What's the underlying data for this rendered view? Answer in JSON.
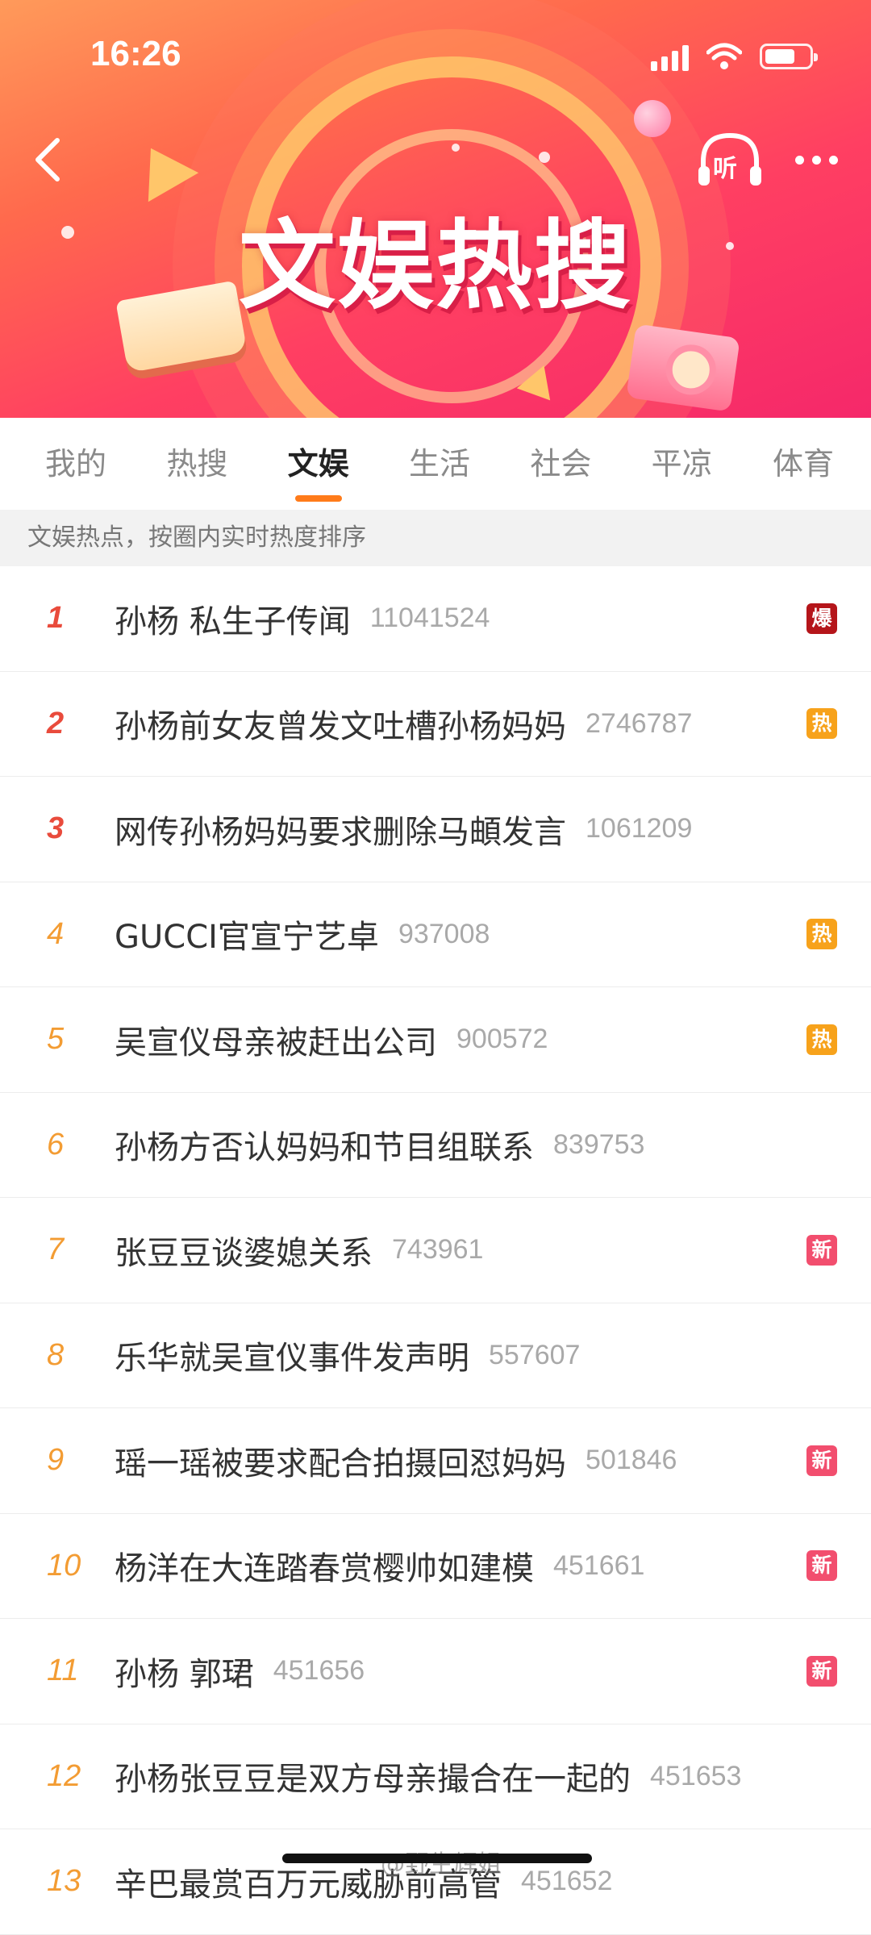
{
  "status_bar": {
    "time": "16:26"
  },
  "header": {
    "banner_title": "文娱热搜",
    "listen_label": "听"
  },
  "tabs": [
    {
      "label": "我的",
      "active": false
    },
    {
      "label": "热搜",
      "active": false
    },
    {
      "label": "文娱",
      "active": true
    },
    {
      "label": "生活",
      "active": false
    },
    {
      "label": "社会",
      "active": false
    },
    {
      "label": "平凉",
      "active": false
    },
    {
      "label": "体育",
      "active": false
    }
  ],
  "subheader": {
    "text": "文娱热点，按圈内实时热度排序"
  },
  "badge_colors": {
    "爆": "#b5151a",
    "热": "#f7a21b",
    "新": "#f24e6e"
  },
  "items": [
    {
      "rank": "1",
      "title": "孙杨 私生子传闻",
      "count": "11041524",
      "badge": "爆"
    },
    {
      "rank": "2",
      "title": "孙杨前女友曾发文吐槽孙杨妈妈",
      "count": "2746787",
      "badge": "热"
    },
    {
      "rank": "3",
      "title": "网传孙杨妈妈要求删除马頔发言",
      "count": "1061209",
      "badge": ""
    },
    {
      "rank": "4",
      "title": "GUCCI官宣宁艺卓",
      "count": "937008",
      "badge": "热"
    },
    {
      "rank": "5",
      "title": "吴宣仪母亲被赶出公司",
      "count": "900572",
      "badge": "热"
    },
    {
      "rank": "6",
      "title": "孙杨方否认妈妈和节目组联系",
      "count": "839753",
      "badge": ""
    },
    {
      "rank": "7",
      "title": "张豆豆谈婆媳关系",
      "count": "743961",
      "badge": "新"
    },
    {
      "rank": "8",
      "title": "乐华就吴宣仪事件发声明",
      "count": "557607",
      "badge": ""
    },
    {
      "rank": "9",
      "title": "瑶一瑶被要求配合拍摄回怼妈妈",
      "count": "501846",
      "badge": "新"
    },
    {
      "rank": "10",
      "title": "杨洋在大连踏春赏樱帅如建模",
      "count": "451661",
      "badge": "新"
    },
    {
      "rank": "11",
      "title": "孙杨 郭珺",
      "count": "451656",
      "badge": "新"
    },
    {
      "rank": "12",
      "title": "孙杨张豆豆是双方母亲撮合在一起的",
      "count": "451653",
      "badge": ""
    },
    {
      "rank": "13",
      "title": "辛巴最赏百万元威胁前高管",
      "count": "451652",
      "badge": ""
    }
  ],
  "watermark": "@野生辉姐"
}
